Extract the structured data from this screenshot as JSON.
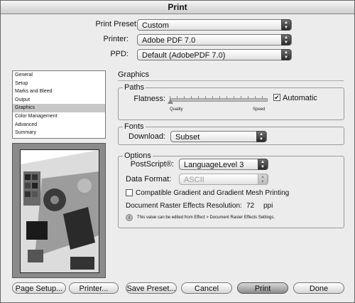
{
  "window": {
    "title": "Print"
  },
  "top": {
    "preset_label": "Print Preset:",
    "preset_value": "Custom",
    "printer_label": "Printer:",
    "printer_value": "Adobe PDF 7.0",
    "ppd_label": "PPD:",
    "ppd_value": "Default (AdobePDF 7.0)"
  },
  "sidebar": {
    "items": [
      "General",
      "Setup",
      "Marks and Bleed",
      "Output",
      "Graphics",
      "Color Management",
      "Advanced",
      "Summary"
    ],
    "selected": "Graphics"
  },
  "panel": {
    "title": "Graphics",
    "paths": {
      "group_label": "Paths",
      "flatness_label": "Flatness:",
      "quality_label": "Quality",
      "speed_label": "Speed",
      "automatic_label": "Automatic",
      "automatic_checked": true,
      "slider_value": 0.0
    },
    "fonts": {
      "group_label": "Fonts",
      "download_label": "Download:",
      "download_value": "Subset"
    },
    "options": {
      "group_label": "Options",
      "postscript_label": "PostScript®:",
      "postscript_value": "LanguageLevel 3",
      "data_format_label": "Data Format:",
      "data_format_value": "ASCII",
      "gradient_label": "Compatible Gradient and Gradient Mesh Printing",
      "gradient_checked": false,
      "raster_label": "Document Raster Effects Resolution:",
      "raster_value": "72",
      "raster_unit": "ppi",
      "info_text": "This value can be edited from Effect > Document Raster Effects Settings."
    }
  },
  "buttons": {
    "page_setup": "Page Setup...",
    "printer": "Printer...",
    "save_preset": "Save Preset...",
    "cancel": "Cancel",
    "print": "Print",
    "done": "Done"
  }
}
